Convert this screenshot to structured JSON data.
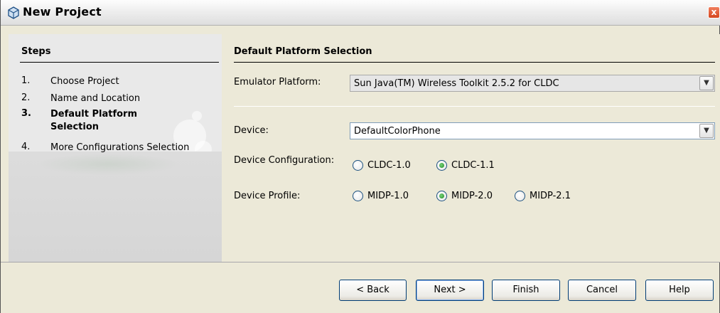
{
  "window": {
    "title": "New Project",
    "close_label": "x"
  },
  "steps": {
    "heading": "Steps",
    "items": [
      {
        "num": "1.",
        "label": "Choose Project",
        "current": false
      },
      {
        "num": "2.",
        "label": "Name and Location",
        "current": false
      },
      {
        "num": "3.",
        "label": "Default Platform Selection",
        "current": true
      },
      {
        "num": "4.",
        "label": "More Configurations Selection",
        "current": false
      }
    ]
  },
  "main": {
    "section_title": "Default Platform Selection",
    "emulator_platform": {
      "label": "Emulator Platform:",
      "value": "Sun Java(TM) Wireless Toolkit 2.5.2 for CLDC"
    },
    "device": {
      "label": "Device:",
      "value": "DefaultColorPhone"
    },
    "device_configuration": {
      "label": "Device Configuration:",
      "options": [
        "CLDC-1.0",
        "CLDC-1.1"
      ],
      "selected": "CLDC-1.1"
    },
    "device_profile": {
      "label": "Device Profile:",
      "options": [
        "MIDP-1.0",
        "MIDP-2.0",
        "MIDP-2.1"
      ],
      "selected": "MIDP-2.0"
    }
  },
  "buttons": {
    "back": "< Back",
    "next": "Next >",
    "finish": "Finish",
    "cancel": "Cancel",
    "help": "Help"
  }
}
